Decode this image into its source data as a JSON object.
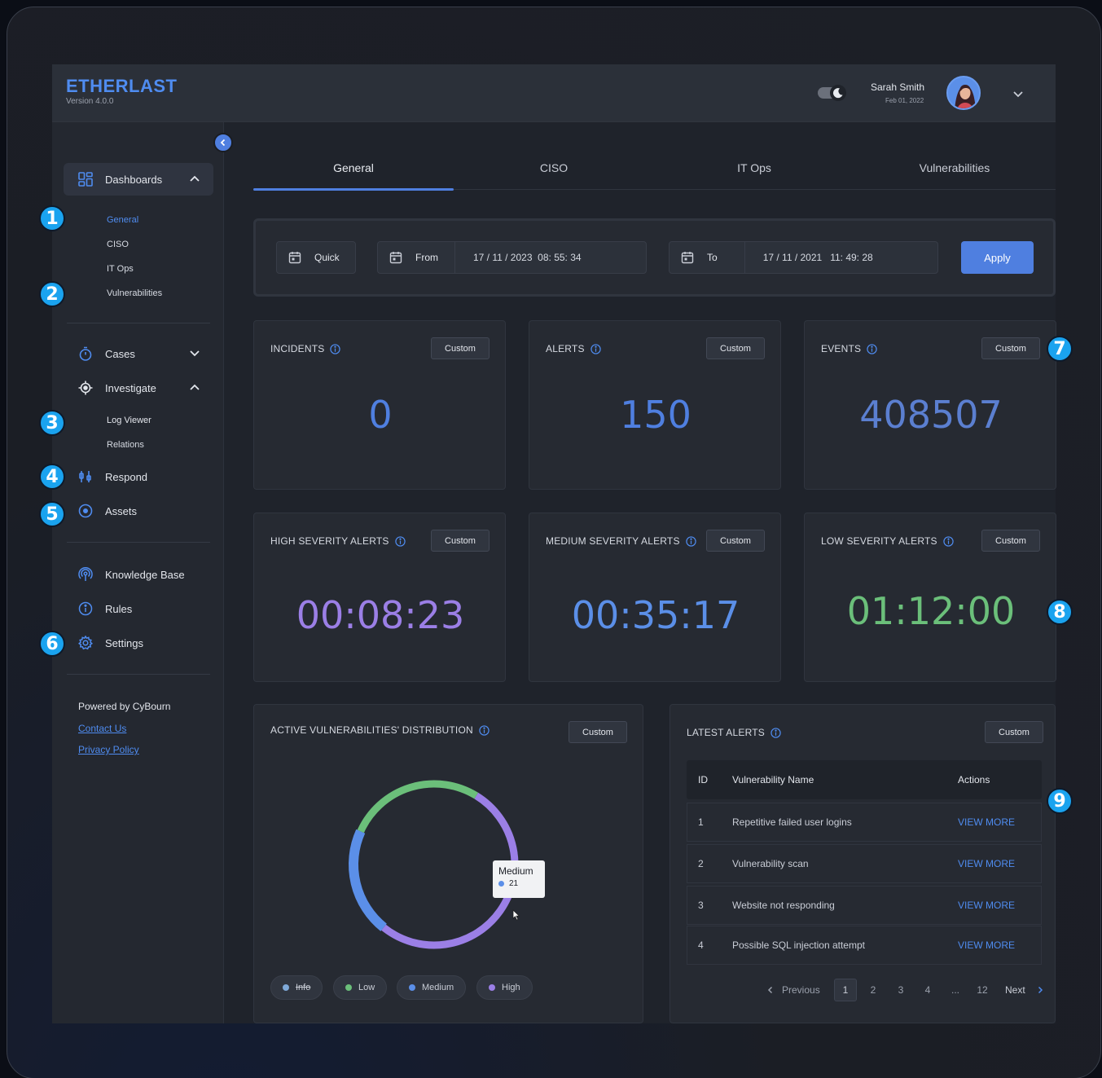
{
  "brand": {
    "name": "ETHERLAST",
    "version": "Version 4.0.0"
  },
  "user": {
    "name": "Sarah Smith",
    "date": "Feb 01, 2022"
  },
  "sidebar": {
    "dashboards": {
      "label": "Dashboards",
      "items": [
        "General",
        "CISO",
        "IT Ops",
        "Vulnerabilities"
      ]
    },
    "cases": "Cases",
    "investigate": {
      "label": "Investigate",
      "items": [
        "Log Viewer",
        "Relations"
      ]
    },
    "respond": "Respond",
    "assets": "Assets",
    "knowledge_base": "Knowledge Base",
    "rules": "Rules",
    "settings": "Settings",
    "footer": {
      "title": "Powered by CyBourn",
      "contact": "Contact Us",
      "privacy": "Privacy Policy"
    }
  },
  "tabs": [
    "General",
    "CISO",
    "IT Ops",
    "Vulnerabilities"
  ],
  "filter": {
    "quick": "Quick",
    "from_label": "From",
    "from_value": "17 / 11 / 2023  08: 55: 34",
    "to_label": "To",
    "to_value": "17 / 11 / 2021   11: 49: 28",
    "apply": "Apply"
  },
  "custom_label": "Custom",
  "cards": {
    "incidents": {
      "title": "INCIDENTS",
      "value": "0"
    },
    "alerts": {
      "title": "ALERTS",
      "value": "150"
    },
    "events": {
      "title": "EVENTS",
      "value": "408507"
    },
    "high": {
      "title": "HIGH SEVERITY ALERTS",
      "value": "00:08:23"
    },
    "medium": {
      "title": "MEDIUM SEVERITY ALERTS",
      "value": "00:35:17"
    },
    "low": {
      "title": "LOW SEVERITY ALERTS",
      "value": "01:12:00"
    }
  },
  "colors": {
    "accent": "#4f7fe0",
    "count_value": "#4f7fe0",
    "high": "#9b7fe6",
    "medium": "#5b8fe8",
    "low": "#6bbf7a",
    "info": "#7fa9d8"
  },
  "vuln_panel": {
    "title": "ACTIVE VULNERABILITIES' DISTRIBUTION",
    "tooltip": {
      "label": "Medium",
      "value": "21"
    },
    "legend": [
      "Info",
      "Low",
      "Medium",
      "High"
    ]
  },
  "chart_data": {
    "type": "pie",
    "variant": "donut",
    "categories": [
      "Info",
      "Low",
      "Medium",
      "High"
    ],
    "values": [
      0,
      27,
      21,
      52
    ],
    "colors": [
      "#7fa9d8",
      "#6bbf7a",
      "#5b8fe8",
      "#9b7fe6"
    ],
    "hidden": [
      "Info"
    ],
    "legend_position": "bottom"
  },
  "alerts_panel": {
    "title": "LATEST ALERTS",
    "headers": [
      "ID",
      "Vulnerability Name",
      "Actions"
    ],
    "rows": [
      {
        "id": "1",
        "name": "Repetitive failed user logins",
        "action": "VIEW MORE"
      },
      {
        "id": "2",
        "name": "Vulnerability scan",
        "action": "VIEW MORE"
      },
      {
        "id": "3",
        "name": "Website not responding",
        "action": "VIEW MORE"
      },
      {
        "id": "4",
        "name": "Possible SQL injection attempt",
        "action": "VIEW MORE"
      }
    ],
    "pagination": {
      "previous": "Previous",
      "pages": [
        "1",
        "2",
        "3",
        "4",
        "...",
        "12"
      ],
      "next": "Next",
      "current": "1"
    }
  },
  "badges": [
    "1",
    "2",
    "3",
    "4",
    "5",
    "6",
    "7",
    "8",
    "9"
  ]
}
